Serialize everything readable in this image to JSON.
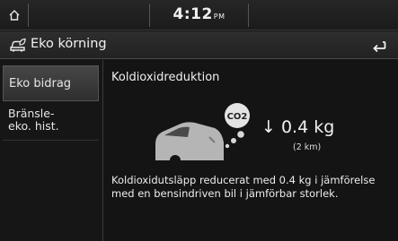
{
  "status_bar": {
    "time": "4:12",
    "ampm": "PM",
    "home_icon": "home-icon"
  },
  "title_bar": {
    "title": "Eko körning",
    "icon": "eco-car-icon",
    "back_icon": "back-arrow-icon"
  },
  "sidebar": {
    "items": [
      {
        "label": "Eko bidrag",
        "active": true
      },
      {
        "label_line1": "Bränsle-",
        "label_line2": "eko. hist."
      }
    ]
  },
  "content": {
    "heading": "Koldioxidreduktion",
    "bubble_label": "CO2",
    "amount": "0.4 kg",
    "distance": "(2 km)",
    "description": "Koldioxidutsläpp reducerat med 0.4 kg i jämförelse med en bensindriven bil i jämförbar storlek."
  },
  "colors": {
    "background": "#141414",
    "bar": "#262626",
    "text": "#e8e8e8"
  }
}
